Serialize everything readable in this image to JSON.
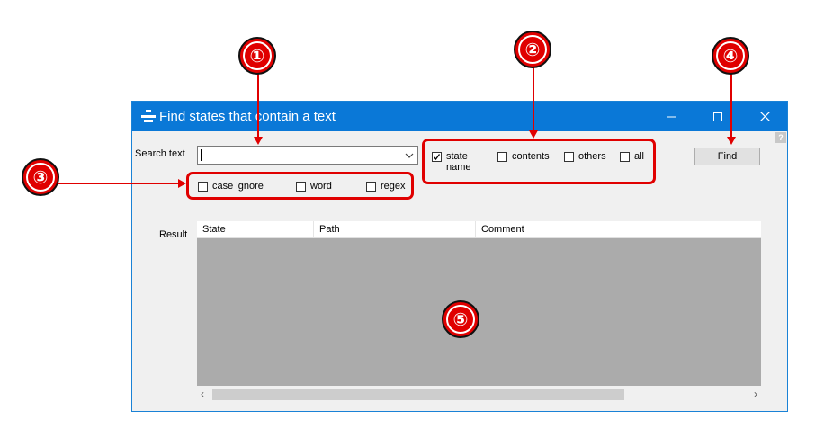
{
  "window": {
    "title": "Find states that contain a text",
    "icon": "app-state-icon",
    "help": "?"
  },
  "search": {
    "label": "Search text",
    "value": ""
  },
  "options": {
    "case_ignore": {
      "label": "case ignore",
      "checked": false
    },
    "word": {
      "label": "word",
      "checked": false
    },
    "regex": {
      "label": "regex",
      "checked": false
    }
  },
  "scope": {
    "state_name": {
      "label": "state\nname",
      "checked": true
    },
    "contents": {
      "label": "contents",
      "checked": false
    },
    "others": {
      "label": "others",
      "checked": false
    },
    "all": {
      "label": "all",
      "checked": false
    }
  },
  "find_button": "Find",
  "result": {
    "label": "Result",
    "columns": [
      "State",
      "Path",
      "Comment"
    ]
  },
  "annotations": {
    "n1": "①",
    "n2": "②",
    "n3": "③",
    "n4": "④",
    "n5": "⑤"
  },
  "colors": {
    "titlebar": "#0a78d7",
    "highlight": "#e00000"
  }
}
